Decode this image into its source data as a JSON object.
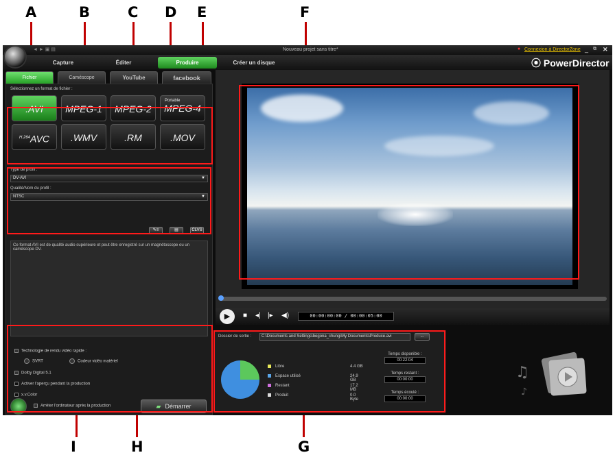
{
  "callouts": {
    "a": "A",
    "b": "B",
    "c": "C",
    "d": "D",
    "e": "E",
    "f": "F",
    "g": "G",
    "h": "H",
    "i": "I"
  },
  "window": {
    "title": "Nouveau projet sans titre*",
    "connect_link": "Connexion à DirectorZone",
    "brand": "PowerDirector"
  },
  "menu": {
    "capture": "Capture",
    "edit": "Éditer",
    "produce": "Produire",
    "disc": "Créer un disque"
  },
  "subtabs": {
    "file": "Fichier",
    "camcorder": "Caméscope",
    "youtube": "YouTube",
    "facebook": "facebook"
  },
  "format": {
    "heading": "Sélectionnez un format de fichier :",
    "buttons": [
      {
        "label": ".AVI",
        "sup": ""
      },
      {
        "label": "MPEG-1",
        "sup": ""
      },
      {
        "label": "MPEG-2",
        "sup": ""
      },
      {
        "label": "MPEG-4",
        "sup": "Portable"
      },
      {
        "label": "AVC",
        "sup": "H.264"
      },
      {
        "label": ".WMV",
        "sup": ""
      },
      {
        "label": ".RM",
        "sup": ""
      },
      {
        "label": ".MOV",
        "sup": ""
      }
    ]
  },
  "profile": {
    "type_label": "Type de profil :",
    "type_value": "DV-AVI",
    "quality_label": "Qualité/Nom du profil :",
    "quality_value": "NTSC",
    "btn3": "CLVS"
  },
  "description": "Ce format AVI est de qualité audio supérieure et peut être enregistré sur un magnétoscope ou un caméscope DV.",
  "options": {
    "fast_render": "Technologie de rendu vidéo rapide :",
    "svrt": "SVRT",
    "hw_encoder": "Codeur vidéo matériel",
    "dolby": "Dolby Digital 5.1",
    "preview": "Activer l'aperçu pendant la production",
    "xvcolor": "x.v.Color",
    "shutdown": "Arrêter l'ordinateur après la production",
    "start": "Démarrer"
  },
  "player": {
    "timecode": "00:00:00:00  /  00:00:05:00"
  },
  "output": {
    "folder_label": "Dossier de sortie :",
    "path": "C:\\Documents and Settings\\begona_chung\\My Documents\\Produce.avi",
    "browse": "...",
    "legend": [
      {
        "name": "Libre",
        "value": "4.4 GB",
        "color": "#e8e85a"
      },
      {
        "name": "Espace utilisé",
        "value": "24.9 GB",
        "color": "#5aa6e8"
      },
      {
        "name": "Restant",
        "value": "17.2 MB",
        "color": "#d070e0"
      },
      {
        "name": "Produit",
        "value": "0.0 Byte",
        "color": "#dddddd"
      }
    ],
    "time_available_label": "Temps disponible :",
    "time_available": "00:22:04",
    "time_remaining_label": "Temps restant :",
    "time_remaining": "00:00:00",
    "time_elapsed_label": "Temps écoulé :",
    "time_elapsed": "00:00:00"
  }
}
